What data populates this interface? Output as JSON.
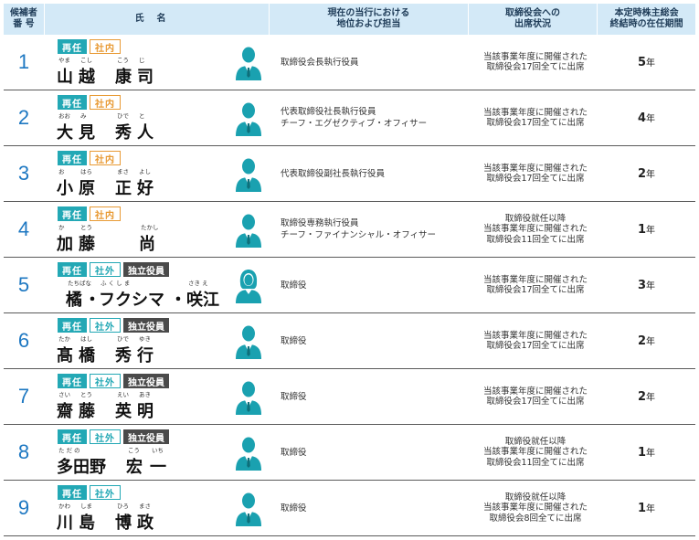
{
  "headers": {
    "no": "候補者\n番 号",
    "name": "氏名",
    "position": "現在の当行における\n地位および担当",
    "attendance": "取締役会への\n出席状況",
    "tenure": "本定時株主総会\n終結時の在任期間"
  },
  "rows": [
    {
      "no": "1",
      "badges": [
        {
          "text": "再任",
          "kind": "re"
        },
        {
          "text": "社内",
          "kind": "in"
        }
      ],
      "name": [
        {
          "ruby": "やま",
          "kanji": "山"
        },
        {
          "ruby": "こし",
          "kanji": "越"
        },
        {
          "ruby": "こう",
          "kanji": "康"
        },
        {
          "ruby": "じ",
          "kanji": "司"
        }
      ],
      "gender": "male",
      "position": [
        "取締役会長執行役員"
      ],
      "attendance": [
        "当該事業年度に開催された",
        "取締役会17回全てに出席"
      ],
      "tenure_num": "5",
      "tenure_unit": "年"
    },
    {
      "no": "2",
      "badges": [
        {
          "text": "再任",
          "kind": "re"
        },
        {
          "text": "社内",
          "kind": "in"
        }
      ],
      "name": [
        {
          "ruby": "おお",
          "kanji": "大"
        },
        {
          "ruby": "み",
          "kanji": "見"
        },
        {
          "ruby": "ひで",
          "kanji": "秀"
        },
        {
          "ruby": "と",
          "kanji": "人"
        }
      ],
      "gender": "male",
      "position": [
        "代表取締役社長執行役員",
        "チーフ・エグゼクティブ・オフィサー"
      ],
      "attendance": [
        "当該事業年度に開催された",
        "取締役会17回全てに出席"
      ],
      "tenure_num": "4",
      "tenure_unit": "年"
    },
    {
      "no": "3",
      "badges": [
        {
          "text": "再任",
          "kind": "re"
        },
        {
          "text": "社内",
          "kind": "in"
        }
      ],
      "name": [
        {
          "ruby": "お",
          "kanji": "小"
        },
        {
          "ruby": "はら",
          "kanji": "原"
        },
        {
          "ruby": "まさ",
          "kanji": "正"
        },
        {
          "ruby": "よし",
          "kanji": "好"
        }
      ],
      "gender": "male",
      "position": [
        "代表取締役副社長執行役員"
      ],
      "attendance": [
        "当該事業年度に開催された",
        "取締役会17回全てに出席"
      ],
      "tenure_num": "2",
      "tenure_unit": "年"
    },
    {
      "no": "4",
      "badges": [
        {
          "text": "再任",
          "kind": "re"
        },
        {
          "text": "社内",
          "kind": "in"
        }
      ],
      "name": [
        {
          "ruby": "か",
          "kanji": "加"
        },
        {
          "ruby": "とう",
          "kanji": "藤"
        },
        {
          "ruby": "",
          "kanji": ""
        },
        {
          "ruby": "たかし",
          "kanji": "尚"
        }
      ],
      "gender": "male",
      "position": [
        "取締役専務執行役員",
        "チーフ・ファイナンシャル・オフィサー"
      ],
      "attendance": [
        "取締役就任以降",
        "当該事業年度に開催された",
        "取締役会11回全てに出席"
      ],
      "tenure_num": "1",
      "tenure_unit": "年"
    },
    {
      "no": "5",
      "badges": [
        {
          "text": "再任",
          "kind": "re"
        },
        {
          "text": "社外",
          "kind": "out"
        },
        {
          "text": "独立役員",
          "kind": "ind"
        }
      ],
      "name": [
        {
          "ruby": "たちばな",
          "kanji": "橘"
        },
        {
          "ruby": "",
          "kanji": "・"
        },
        {
          "ruby": "ふ く し ま",
          "kanji": "フクシマ"
        },
        {
          "ruby": "",
          "kanji": "・"
        },
        {
          "ruby": "さき え",
          "kanji": "咲江"
        }
      ],
      "gender": "female",
      "position": [
        "取締役"
      ],
      "attendance": [
        "当該事業年度に開催された",
        "取締役会17回全てに出席"
      ],
      "tenure_num": "3",
      "tenure_unit": "年"
    },
    {
      "no": "6",
      "badges": [
        {
          "text": "再任",
          "kind": "re"
        },
        {
          "text": "社外",
          "kind": "out"
        },
        {
          "text": "独立役員",
          "kind": "ind"
        }
      ],
      "name": [
        {
          "ruby": "たか",
          "kanji": "髙"
        },
        {
          "ruby": "はし",
          "kanji": "橋"
        },
        {
          "ruby": "ひで",
          "kanji": "秀"
        },
        {
          "ruby": "ゆき",
          "kanji": "行"
        }
      ],
      "gender": "male",
      "position": [
        "取締役"
      ],
      "attendance": [
        "当該事業年度に開催された",
        "取締役会17回全てに出席"
      ],
      "tenure_num": "2",
      "tenure_unit": "年"
    },
    {
      "no": "7",
      "badges": [
        {
          "text": "再任",
          "kind": "re"
        },
        {
          "text": "社外",
          "kind": "out"
        },
        {
          "text": "独立役員",
          "kind": "ind"
        }
      ],
      "name": [
        {
          "ruby": "さい",
          "kanji": "齋"
        },
        {
          "ruby": "とう",
          "kanji": "藤"
        },
        {
          "ruby": "えい",
          "kanji": "英"
        },
        {
          "ruby": "あき",
          "kanji": "明"
        }
      ],
      "gender": "male",
      "position": [
        "取締役"
      ],
      "attendance": [
        "当該事業年度に開催された",
        "取締役会17回全てに出席"
      ],
      "tenure_num": "2",
      "tenure_unit": "年"
    },
    {
      "no": "8",
      "badges": [
        {
          "text": "再任",
          "kind": "re"
        },
        {
          "text": "社外",
          "kind": "out"
        },
        {
          "text": "独立役員",
          "kind": "ind"
        }
      ],
      "name": [
        {
          "ruby": "た だ の",
          "kanji": "多田野"
        },
        {
          "ruby": "こう",
          "kanji": "宏"
        },
        {
          "ruby": "いち",
          "kanji": "一"
        }
      ],
      "gender": "male",
      "position": [
        "取締役"
      ],
      "attendance": [
        "取締役就任以降",
        "当該事業年度に開催された",
        "取締役会11回全てに出席"
      ],
      "tenure_num": "1",
      "tenure_unit": "年"
    },
    {
      "no": "9",
      "badges": [
        {
          "text": "再任",
          "kind": "re"
        },
        {
          "text": "社外",
          "kind": "out"
        }
      ],
      "name": [
        {
          "ruby": "かわ",
          "kanji": "川"
        },
        {
          "ruby": "しま",
          "kanji": "島"
        },
        {
          "ruby": "ひろ",
          "kanji": "博"
        },
        {
          "ruby": "まさ",
          "kanji": "政"
        }
      ],
      "gender": "male",
      "position": [
        "取締役"
      ],
      "attendance": [
        "取締役就任以降",
        "当該事業年度に開催された",
        "取締役会8回全てに出席"
      ],
      "tenure_num": "1",
      "tenure_unit": "年"
    }
  ],
  "colors": {
    "header_bg": "#d3e9f7",
    "number_blue": "#1e78c2",
    "badge_teal": "#23a8b5",
    "badge_orange": "#e89a34",
    "badge_dark": "#4a4a4a",
    "avatar_teal": "#1aa1b0"
  },
  "icons": {
    "male": "male-person-icon",
    "female": "female-person-icon"
  }
}
